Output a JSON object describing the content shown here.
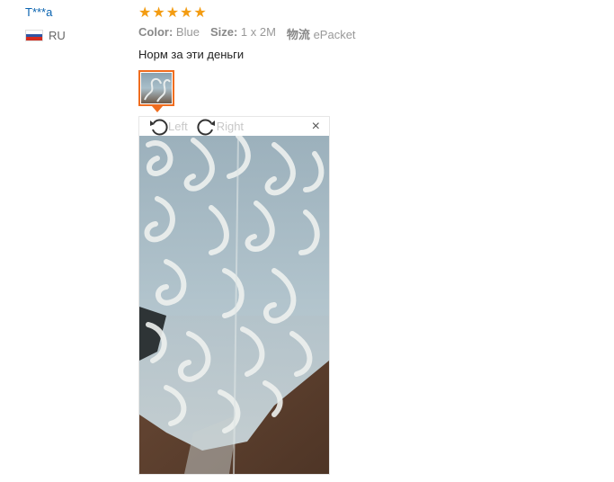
{
  "review": {
    "user_name": "T***a",
    "country_code": "RU",
    "flag_colors": [
      "#ffffff",
      "#2f55a4",
      "#d52b1e"
    ],
    "rating": 5,
    "stars": "★★★★★",
    "color_label": "Color:",
    "color_value": "Blue",
    "size_label": "Size:",
    "size_value": "1 x 2M",
    "shipping_label": "物流",
    "shipping_value": "ePacket",
    "text": "Норм за эти деньги"
  },
  "viewer": {
    "rotate_left_label": "Left",
    "rotate_right_label": "Right",
    "close_glyph": "×"
  },
  "colors": {
    "accent": "#f06d1f",
    "star": "#f39c12",
    "user_link": "#0a63b0"
  }
}
